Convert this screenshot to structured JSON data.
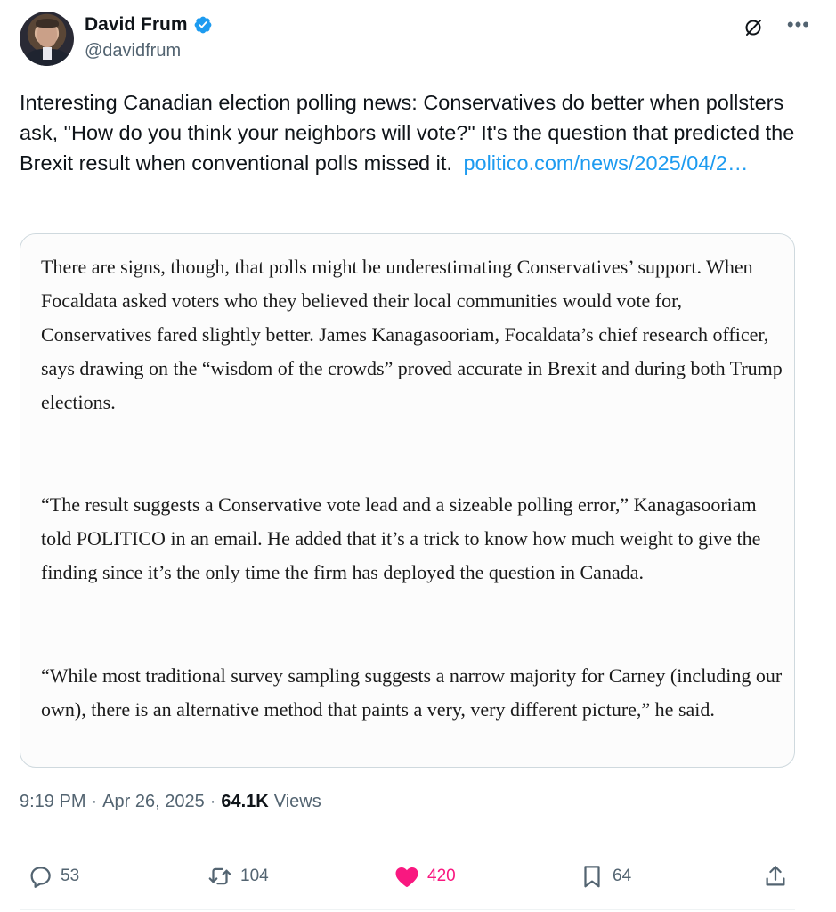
{
  "author": {
    "display_name": "David Frum",
    "handle": "@davidfrum",
    "verified": true
  },
  "tweet": {
    "text": "Interesting Canadian election polling news: Conservatives do better when pollsters ask, \"How do you think your neighbors will vote?\" It's the question that predicted the Brexit result when conventional polls missed it.",
    "link_text": "politico.com/news/2025/04/2…"
  },
  "quote": {
    "paragraphs": [
      "There are signs, though, that polls might be underestimating Conservatives’ support. When Focaldata asked voters who they believed their local communities would vote for, Conservatives fared slightly better. James Kanagasooriam, Focaldata’s chief research officer, says drawing on the “wisdom of the crowds” proved accurate in Brexit and during both Trump elections.",
      "“The result suggests a Conservative vote lead and a sizeable polling error,” Kanagasooriam told POLITICO in an email. He added that it’s a trick to know how much weight to give the finding since it’s the only time the firm has deployed the question in Canada.",
      "“While most traditional survey sampling suggests a narrow majority for Carney (including our own), there is an alternative method that paints a very, very different picture,” he said."
    ]
  },
  "meta": {
    "time": "9:19 PM",
    "separator": "·",
    "date": "Apr 26, 2025",
    "views_count": "64.1K",
    "views_label": "Views"
  },
  "actions": {
    "replies": "53",
    "reposts": "104",
    "likes": "420",
    "bookmarks": "64"
  },
  "colors": {
    "accent": "#1d9bf0",
    "like": "#f91880",
    "secondary_text": "#536471"
  },
  "icons": [
    "verified-badge-icon",
    "grok-icon",
    "more-icon",
    "reply-icon",
    "repost-icon",
    "like-icon",
    "bookmark-icon",
    "share-icon"
  ]
}
